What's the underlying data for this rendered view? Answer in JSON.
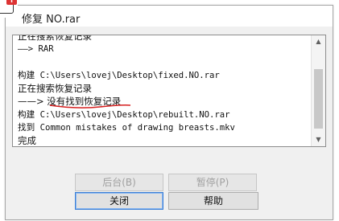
{
  "window": {
    "title": "修复 NO.rar"
  },
  "log": {
    "lines": [
      {
        "text": "正在搜索恢复记录",
        "style": "cn"
      },
      {
        "text": "——> RAR",
        "style": "mono"
      },
      {
        "text": "",
        "style": "mono"
      },
      {
        "text": "构建 C:\\Users\\lovej\\Desktop\\fixed.NO.rar",
        "style": "mono"
      },
      {
        "text": "正在搜索恢复记录",
        "style": "cn"
      },
      {
        "text": "——> 没有找到恢复记录",
        "style": "cn"
      },
      {
        "text": "构建 C:\\Users\\lovej\\Desktop\\rebuilt.NO.rar",
        "style": "mono"
      },
      {
        "text": "找到 Common mistakes of drawing breasts.mkv",
        "style": "mono"
      },
      {
        "text": "完成",
        "style": "cn"
      }
    ]
  },
  "buttons": {
    "background": "后台(B)",
    "pause": "暂停(P)",
    "close": "关闭",
    "help": "帮助"
  },
  "colors": {
    "annotation_underline": "#d62020",
    "focus_border": "#3c7fd6"
  }
}
